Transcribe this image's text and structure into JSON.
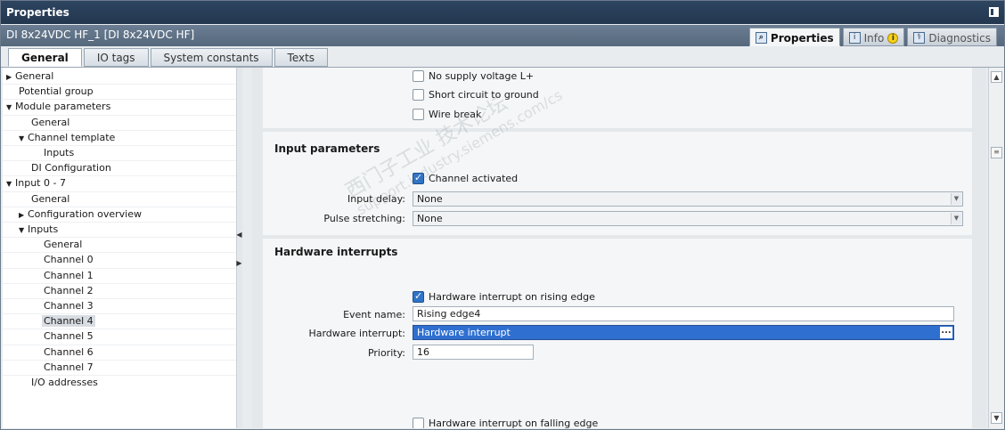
{
  "window": {
    "title": "Properties"
  },
  "device": {
    "name": "DI 8x24VDC HF_1 [DI 8x24VDC HF]"
  },
  "top_tabs": [
    {
      "label": "Properties",
      "icon": "properties-icon",
      "active": true
    },
    {
      "label": "Info",
      "icon": "info-icon",
      "badge": "i"
    },
    {
      "label": "Diagnostics",
      "icon": "diagnostics-icon"
    }
  ],
  "section_tabs": [
    {
      "label": "General",
      "active": true
    },
    {
      "label": "IO tags"
    },
    {
      "label": "System constants"
    },
    {
      "label": "Texts"
    }
  ],
  "tree": [
    {
      "label": "General",
      "arrow": "right"
    },
    {
      "label": "Potential group"
    },
    {
      "label": "Module parameters",
      "arrow": "down"
    },
    {
      "label": "General"
    },
    {
      "label": "Channel template",
      "arrow": "down"
    },
    {
      "label": "Inputs"
    },
    {
      "label": "DI Configuration"
    },
    {
      "label": "Input 0 - 7",
      "arrow": "down"
    },
    {
      "label": "General"
    },
    {
      "label": "Configuration overview",
      "arrow": "right"
    },
    {
      "label": "Inputs",
      "arrow": "down"
    },
    {
      "label": "General"
    },
    {
      "label": "Channel 0"
    },
    {
      "label": "Channel 1"
    },
    {
      "label": "Channel 2"
    },
    {
      "label": "Channel 3"
    },
    {
      "label": "Channel 4",
      "selected": true
    },
    {
      "label": "Channel 5"
    },
    {
      "label": "Channel 6"
    },
    {
      "label": "Channel 7"
    },
    {
      "label": "I/O addresses"
    }
  ],
  "diagnostics_checks": [
    {
      "label": "No supply voltage L+",
      "checked": false
    },
    {
      "label": "Short circuit to ground",
      "checked": false
    },
    {
      "label": "Wire break",
      "checked": false
    }
  ],
  "input_params": {
    "title": "Input parameters",
    "channel_activated": "Channel activated",
    "input_delay_label": "Input delay:",
    "input_delay_value": "None",
    "pulse_label": "Pulse stretching:",
    "pulse_value": "None"
  },
  "hw_interrupts": {
    "title": "Hardware interrupts",
    "rising_label": "Hardware interrupt on rising edge",
    "event_label": "Event name:",
    "event_value": "Rising edge4",
    "hw_label": "Hardware interrupt:",
    "hw_value": "Hardware interrupt",
    "priority_label": "Priority:",
    "priority_value": "16",
    "falling_label": "Hardware interrupt on falling edge"
  },
  "watermark": {
    "line1": "西门子工业 技术论坛",
    "line2": "support.industry.siemens.com/cs"
  }
}
